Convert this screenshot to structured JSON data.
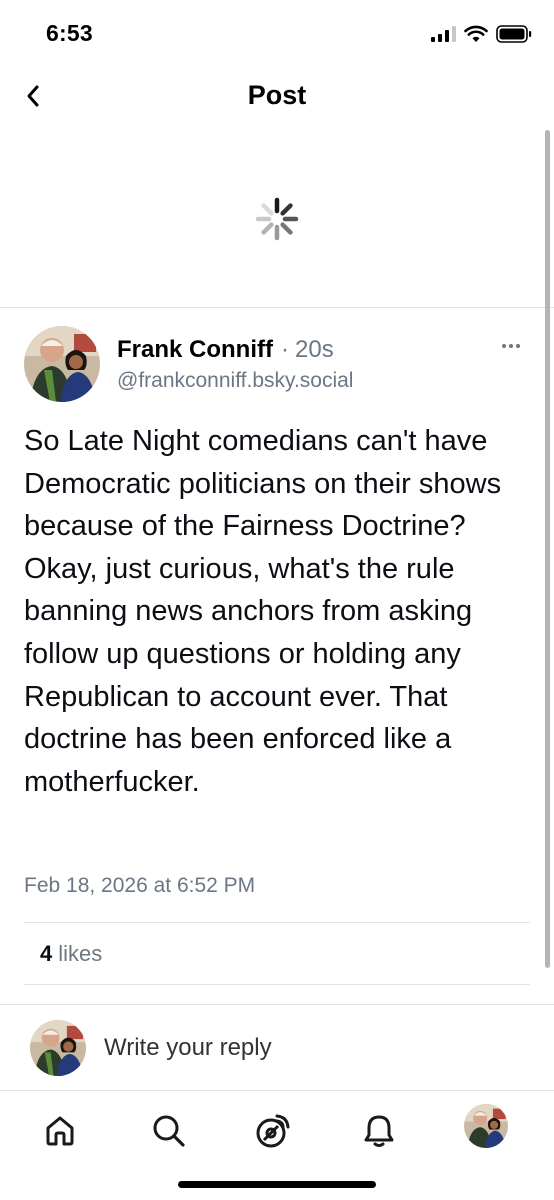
{
  "status_bar": {
    "time": "6:53",
    "icons": [
      "signal-icon",
      "wifi-icon",
      "battery-icon"
    ]
  },
  "header": {
    "title": "Post",
    "back_icon": "chevron-left-icon"
  },
  "loading": {
    "icon": "spinner-icon"
  },
  "post": {
    "author_name": "Frank Conniff",
    "separator": "·",
    "age": "20s",
    "handle": "@frankconniff.bsky.social",
    "text": "So Late Night comedians can't have Democratic politicians on their shows because of the Fairness Doctrine? Okay, just curious, what's the rule banning news anchors from asking follow up questions or holding any Republican to account ever. That doctrine has been enforced like a motherfucker.",
    "timestamp": "Feb 18, 2026 at 6:52 PM",
    "likes_count": "4",
    "likes_label": "likes",
    "more_icon": "more-horizontal-icon"
  },
  "reply": {
    "placeholder": "Write your reply"
  },
  "tab_bar": {
    "tabs": [
      "home-icon",
      "search-icon",
      "feeds-icon",
      "notifications-icon",
      "profile-avatar"
    ]
  },
  "colors": {
    "muted_text": "#6b7785",
    "divider": "#e1e4e8",
    "text": "#0b0f14"
  }
}
